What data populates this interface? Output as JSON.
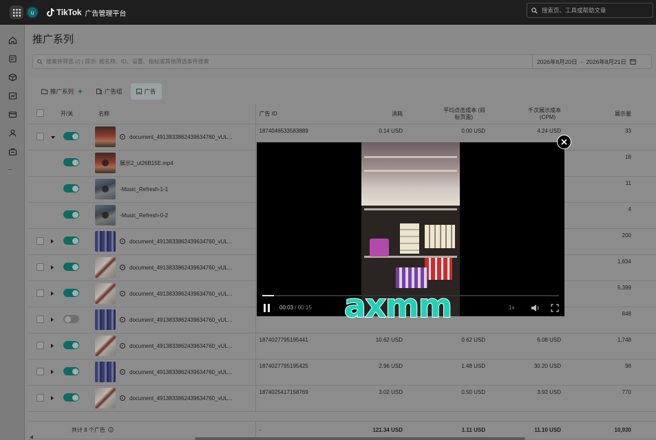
{
  "topbar": {
    "avatar_letter": "u",
    "logo_text": "TikTok",
    "platform_name": "广告管理平台",
    "search_placeholder": "搜索页、工具或帮助文章"
  },
  "rail": {
    "icons": [
      "home-icon",
      "campaign-icon",
      "assets-icon",
      "reports-icon",
      "billing-icon",
      "account-icon",
      "tools-icon",
      "more-icon"
    ],
    "more_label": "···"
  },
  "page": {
    "title": "推广系列",
    "filter_placeholder": "搜索并筛选 (/) | 提示: 按名称、ID、设置、指标或其他筛选条件搜索",
    "date_start": "2026年8月20日",
    "date_sep": "-",
    "date_end": "2026年8月21日"
  },
  "tabs": [
    {
      "label": "推广系列",
      "icon": "folder-icon",
      "active": false
    },
    {
      "label": "广告组",
      "icon": "adgroup-icon",
      "active": false
    },
    {
      "label": "广告",
      "icon": "ad-icon",
      "active": true
    }
  ],
  "table": {
    "headers": {
      "toggle": "开/关",
      "name": "名称",
      "ad_id": "广告 ID",
      "cost": "消耗",
      "cpc_line1": "平均点击成本 (目",
      "cpc_line2": "标页面)",
      "cpm_line1": "千次展示成本",
      "cpm_line2": "(CPM)",
      "impressions": "展示量"
    },
    "rows": [
      {
        "expand": "down",
        "checkbox": true,
        "toggle": "on",
        "thumb": "t1",
        "video_icon": true,
        "name": "document_4913833862439634760_vUL...",
        "ad_id": "1874046533583889",
        "cost": "0.14 USD",
        "cpc": "0.00 USD",
        "cpm": "4.24 USD",
        "impressions": "33"
      },
      {
        "expand": "",
        "checkbox": false,
        "toggle": "on",
        "thumb": "t1",
        "video_icon": false,
        "name": "展示2_ut26B15E.mp4",
        "ad_id": "",
        "cost": "",
        "cpc": "",
        "cpm": "",
        "impressions": "18"
      },
      {
        "expand": "",
        "checkbox": false,
        "toggle": "on",
        "thumb": "t2",
        "video_icon": false,
        "name": "-Music_Refresh-1-1",
        "ad_id": "",
        "cost": "",
        "cpc": "",
        "cpm": "",
        "impressions": "11"
      },
      {
        "expand": "",
        "checkbox": false,
        "toggle": "on",
        "thumb": "t2",
        "video_icon": false,
        "name": "-Music_Refresh-0-2",
        "ad_id": "",
        "cost": "",
        "cpc": "",
        "cpm": "",
        "impressions": "4"
      },
      {
        "expand": "right",
        "checkbox": true,
        "toggle": "on",
        "thumb": "t3",
        "video_icon": true,
        "name": "document_4913833862439634760_vUL...",
        "ad_id": "",
        "cost": "",
        "cpc": "",
        "cpm": "",
        "impressions": "200"
      },
      {
        "expand": "right",
        "checkbox": true,
        "toggle": "on",
        "thumb": "t4",
        "video_icon": true,
        "name": "document_4913833862439634760_vUL...",
        "ad_id": "",
        "cost": "",
        "cpc": "",
        "cpm": "",
        "impressions": "1,834"
      },
      {
        "expand": "right",
        "checkbox": true,
        "toggle": "on",
        "thumb": "t4",
        "video_icon": true,
        "name": "document_4913833862439634760_vUL...",
        "ad_id": "",
        "cost": "",
        "cpc": "",
        "cpm": "",
        "impressions": "5,399"
      },
      {
        "expand": "right",
        "checkbox": true,
        "toggle": "off",
        "thumb": "t3",
        "video_icon": true,
        "name": "document_4913833862439634760_vUL...",
        "ad_id": "",
        "cost": "",
        "cpc": "",
        "cpm": "",
        "impressions": "848"
      },
      {
        "expand": "right",
        "checkbox": true,
        "toggle": "on",
        "thumb": "t4",
        "video_icon": true,
        "name": "document_4913833862439634760_vUL...",
        "ad_id": "1874027795195441",
        "cost": "10.62 USD",
        "cpc": "0.62 USD",
        "cpm": "6.08 USD",
        "impressions": "1,748"
      },
      {
        "expand": "right",
        "checkbox": true,
        "toggle": "on",
        "thumb": "t3",
        "video_icon": true,
        "name": "document_4913833862439634760_vUL...",
        "ad_id": "1874027795195425",
        "cost": "2.96 USD",
        "cpc": "1.48 USD",
        "cpm": "30.20 USD",
        "impressions": "98"
      },
      {
        "expand": "right",
        "checkbox": true,
        "toggle": "on",
        "thumb": "t4",
        "video_icon": true,
        "name": "document_4913833862439634760_vUL...",
        "ad_id": "1874025417158769",
        "cost": "3.02 USD",
        "cpc": "0.50 USD",
        "cpm": "3.92 USD",
        "impressions": "770"
      }
    ],
    "total": {
      "label": "共计 8 个广告",
      "ad_id": "-",
      "cost": "121.34 USD",
      "cpc": "1.11 USD",
      "cpm": "11.10 USD",
      "impressions": "10,930"
    }
  },
  "player": {
    "current_time": "00:03",
    "time_sep": "/",
    "duration": "00:15",
    "speed": "1x",
    "progress_fraction": 0.04,
    "caption": "axmm",
    "caption_color": "#21d1b7"
  }
}
